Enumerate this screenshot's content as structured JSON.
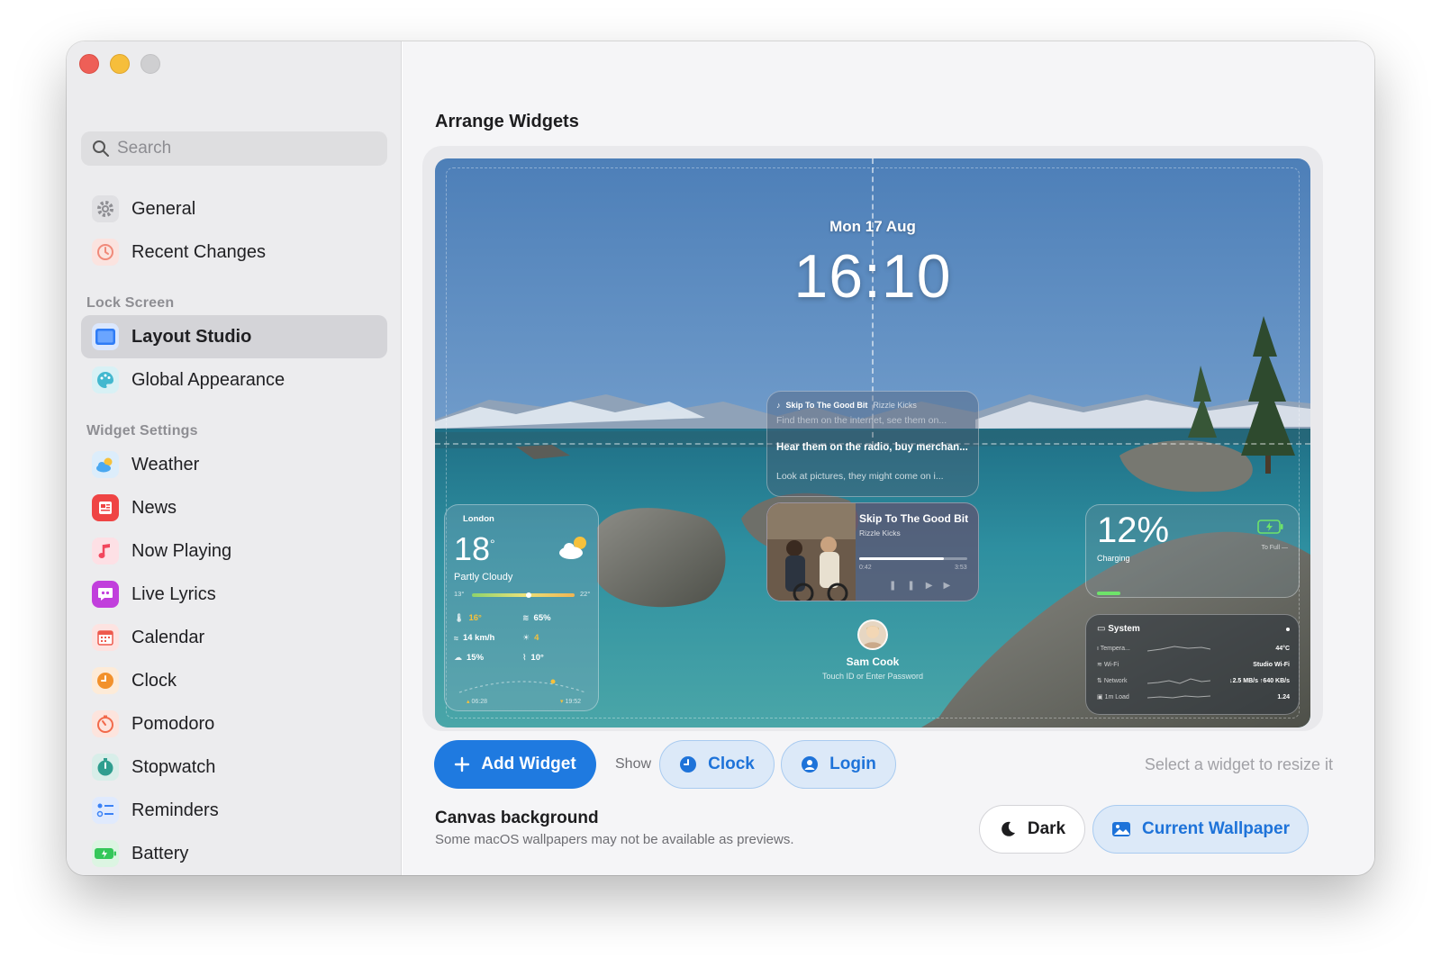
{
  "sidebar": {
    "search": {
      "placeholder": "Search",
      "icon": "magnifier-icon"
    },
    "items_top": [
      {
        "label": "General",
        "icon": "gear-icon",
        "color": "#8e8e93"
      },
      {
        "label": "Recent Changes",
        "icon": "history-icon",
        "color": "#f08a7a"
      }
    ],
    "section_lock": "Lock Screen",
    "items_lock": [
      {
        "label": "Layout Studio",
        "icon": "layout-icon",
        "color": "#2f7cf6",
        "active": true
      },
      {
        "label": "Global Appearance",
        "icon": "palette-icon",
        "color": "#43b8cf"
      }
    ],
    "section_widgets": "Widget Settings",
    "items_widgets": [
      {
        "label": "Weather",
        "icon": "weather-icon",
        "color": "#4aa8f0"
      },
      {
        "label": "News",
        "icon": "news-icon",
        "color": "#ef4444"
      },
      {
        "label": "Now Playing",
        "icon": "music-note-icon",
        "color": "#f2475d"
      },
      {
        "label": "Live Lyrics",
        "icon": "quote-bubble-icon",
        "color": "#c13fdc"
      },
      {
        "label": "Calendar",
        "icon": "calendar-icon",
        "color": "#ee5a4e"
      },
      {
        "label": "Clock",
        "icon": "clock-icon",
        "color": "#f2912c"
      },
      {
        "label": "Pomodoro",
        "icon": "timer-icon",
        "color": "#f26a4b"
      },
      {
        "label": "Stopwatch",
        "icon": "stopwatch-icon",
        "color": "#2f9e8f"
      },
      {
        "label": "Reminders",
        "icon": "reminders-icon",
        "color": "#3b82f6"
      },
      {
        "label": "Battery",
        "icon": "battery-icon",
        "color": "#34c759"
      }
    ]
  },
  "main": {
    "title": "Arrange Widgets",
    "preview": {
      "date": "Mon 17 Aug",
      "time": "16:10",
      "lyrics": {
        "song": "Skip To The Good Bit",
        "artist": "Rizzle Kicks",
        "line1": "Find them on the internet, see them on...",
        "line2": "Hear them on the radio, buy merchan...",
        "line3": "Look at pictures, they might come on i..."
      },
      "now_playing": {
        "song": "Skip To The Good Bit",
        "artist": "Rizzle Kicks",
        "elapsed": "0:42",
        "duration": "3:53",
        "progress": 0.78
      },
      "weather": {
        "city": "London",
        "temp": "18",
        "deg": "°",
        "condition": "Partly Cloudy",
        "low": "13°",
        "high": "22°",
        "feels": "16°",
        "humidity": "65%",
        "wind": "14 km/h",
        "uv": "4",
        "precip": "15%",
        "dew": "10°",
        "sunrise": "06:28",
        "sunset": "19:52"
      },
      "battery": {
        "percent": "12%",
        "label": "Charging",
        "sub": "To Full —",
        "level": 0.12
      },
      "system": {
        "title": "System",
        "rows": [
          {
            "key": "Tempera...",
            "value": "44°C",
            "icon": "thermometer-icon"
          },
          {
            "key": "Wi-Fi",
            "value": "Studio Wi-Fi",
            "icon": "wifi-icon"
          },
          {
            "key": "Network",
            "value": "↓2.5 MB/s ↑640 KB/s",
            "icon": "network-icon"
          },
          {
            "key": "1m Load",
            "value": "1.24",
            "icon": "cpu-icon"
          }
        ]
      },
      "login": {
        "name": "Sam Cook",
        "hint": "Touch ID or Enter Password"
      }
    },
    "toolbar": {
      "add_widget": "Add Widget",
      "show_label": "Show",
      "clock": "Clock",
      "login": "Login",
      "hint": "Select a widget to resize it"
    },
    "canvas_bg": {
      "title": "Canvas background",
      "subtitle": "Some macOS wallpapers may not be available as previews.",
      "dark": "Dark",
      "wallpaper": "Current Wallpaper"
    }
  },
  "colors": {
    "accent": "#1f7ae0",
    "pill_bg": "#dce9f8",
    "sidebar_bg": "#ececee"
  }
}
